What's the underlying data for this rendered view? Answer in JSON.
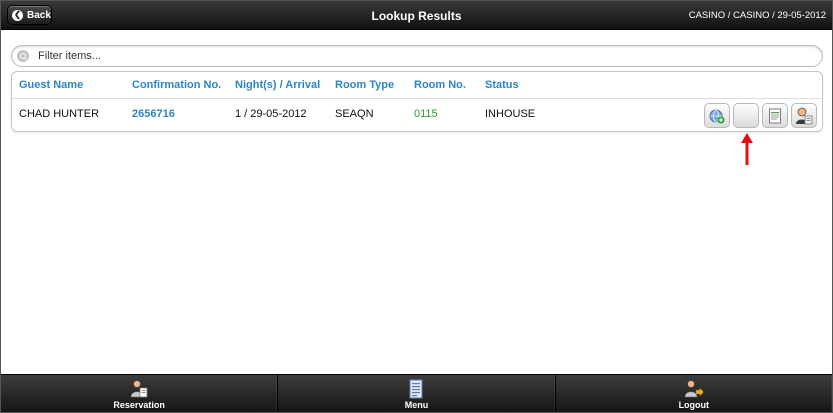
{
  "header": {
    "back_label": "Back",
    "title": "Lookup Results",
    "context": "CASINO / CASINO / 29-05-2012"
  },
  "filter": {
    "placeholder": "Filter items...",
    "value": ""
  },
  "table": {
    "columns": [
      "Guest Name",
      "Confirmation No.",
      "Night(s) / Arrival",
      "Room Type",
      "Room No.",
      "Status"
    ],
    "rows": [
      {
        "guest_name": "CHAD HUNTER",
        "confirmation_no": "2656716",
        "nights_arrival": "1 / 29-05-2012",
        "room_type": "SEAQN",
        "room_no": "0115",
        "status": "INHOUSE"
      }
    ],
    "row_actions": [
      "add-globe-icon",
      "blank-icon",
      "document-icon",
      "guest-profile-icon"
    ]
  },
  "footer": {
    "tabs": [
      {
        "label": "Reservation",
        "icon": "reservation-person-icon"
      },
      {
        "label": "Menu",
        "icon": "menu-document-icon"
      },
      {
        "label": "Logout",
        "icon": "logout-person-icon"
      }
    ]
  },
  "colors": {
    "header_bg": "#1c1c1c",
    "link_blue": "#2b86c5",
    "room_green": "#2a9a2a",
    "annotation_red": "#e01010"
  }
}
